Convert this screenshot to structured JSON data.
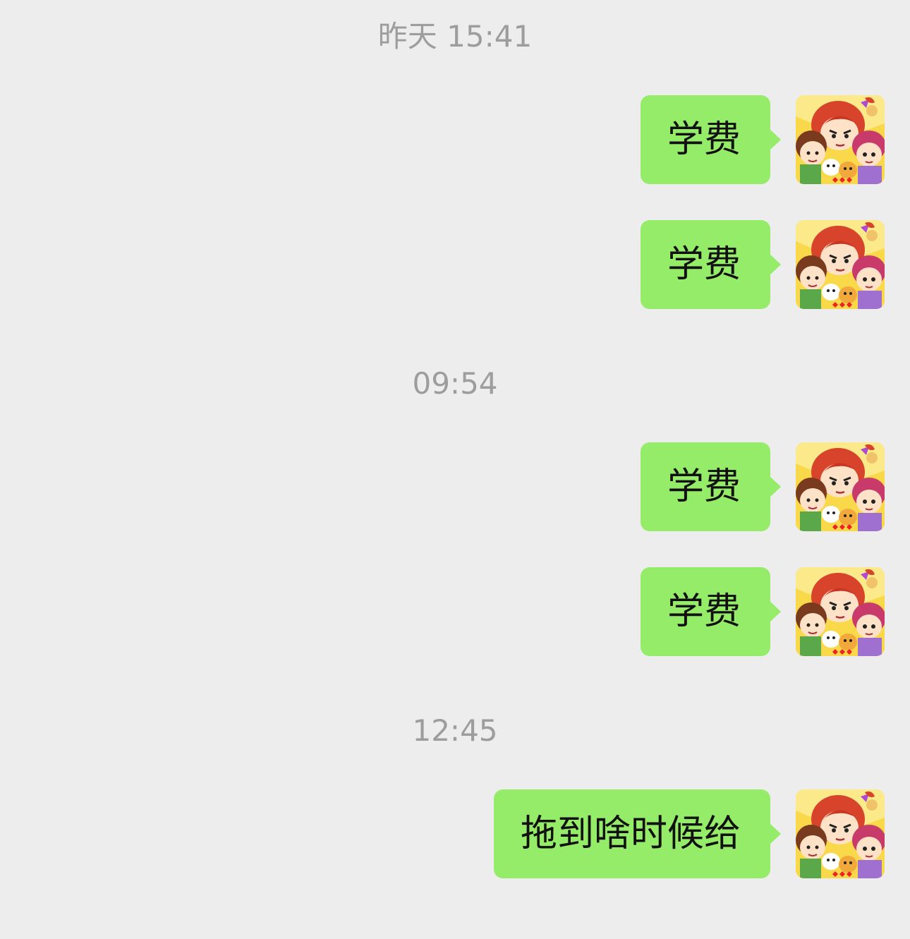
{
  "chat": {
    "timestamps": [
      {
        "text": "昨天 15:41"
      },
      {
        "text": "09:54"
      },
      {
        "text": "12:45"
      }
    ],
    "messages": [
      {
        "text": "学费",
        "sender": "self",
        "avatar_icon": "cartoon-group-avatar-icon"
      },
      {
        "text": "学费",
        "sender": "self",
        "avatar_icon": "cartoon-group-avatar-icon"
      },
      {
        "text": "学费",
        "sender": "self",
        "avatar_icon": "cartoon-group-avatar-icon"
      },
      {
        "text": "学费",
        "sender": "self",
        "avatar_icon": "cartoon-group-avatar-icon"
      },
      {
        "text": "拖到啥时候给",
        "sender": "self",
        "avatar_icon": "cartoon-group-avatar-icon"
      }
    ]
  },
  "colors": {
    "background": "#ededed",
    "bubble_self": "#95ec69",
    "timestamp_text": "#9d9d9d",
    "message_text": "#111111"
  }
}
